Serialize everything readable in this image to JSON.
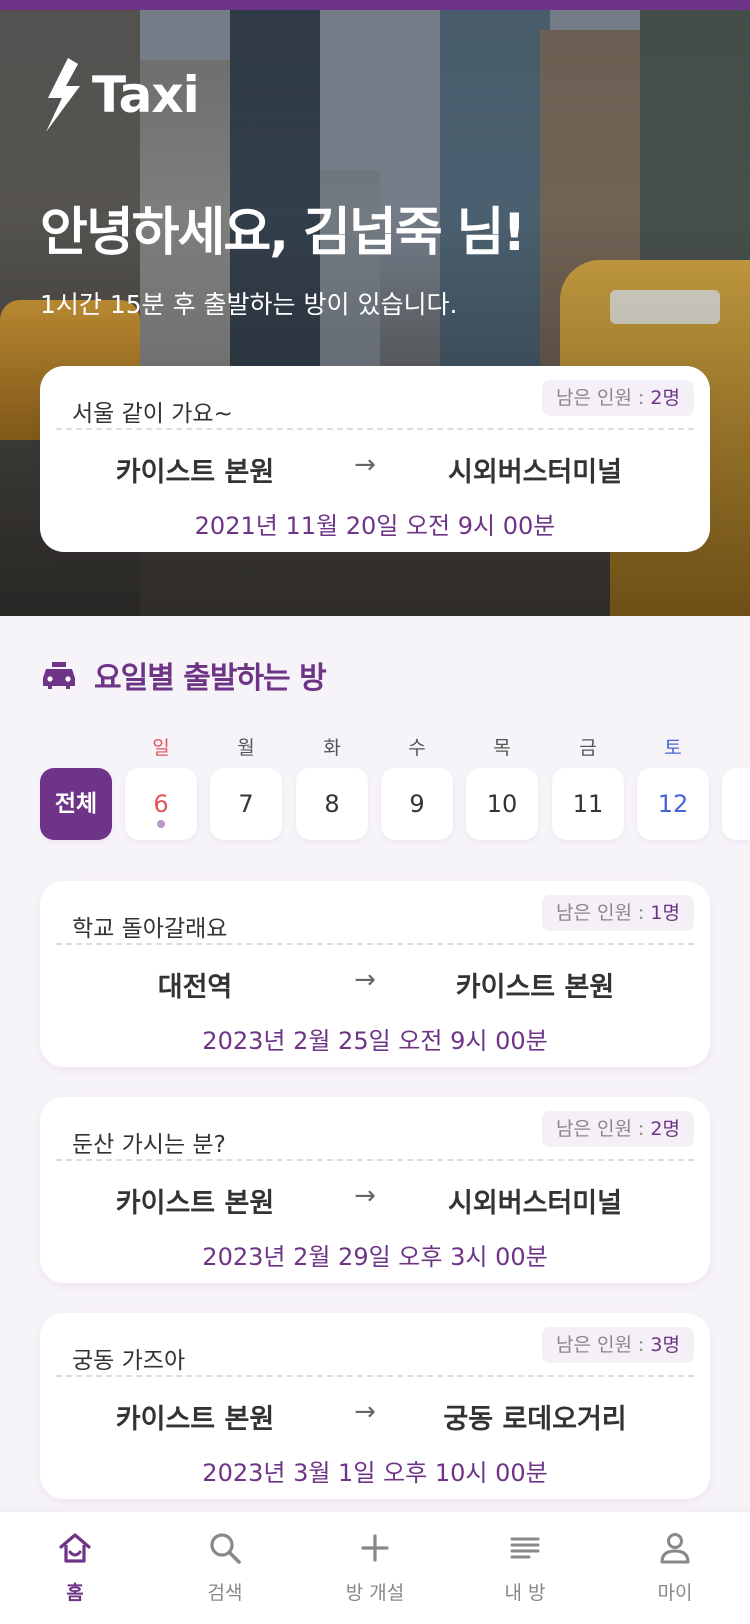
{
  "app": {
    "logo_text": "Taxi"
  },
  "hero": {
    "greeting": "안녕하세요, 김넙죽 님!",
    "subtitle": "1시간 15분 후 출발하는 방이 있습니다.",
    "card": {
      "title": "서울 같이 가요~",
      "remaining_label": "남은 인원 : ",
      "remaining_count": "2명",
      "from": "카이스트 본원",
      "arrow": "→",
      "to": "시외버스터미널",
      "datetime": "2021년 11월 20일 오전 9시 00분"
    }
  },
  "section": {
    "title": "요일별 출발하는 방",
    "icon": "taxi-icon"
  },
  "calendar": {
    "all_label": "전체",
    "days": [
      {
        "weekday": "일",
        "date": "6",
        "color": "#e0555e",
        "has_dot": true
      },
      {
        "weekday": "월",
        "date": "7",
        "color": "#333333"
      },
      {
        "weekday": "화",
        "date": "8",
        "color": "#333333"
      },
      {
        "weekday": "수",
        "date": "9",
        "color": "#333333"
      },
      {
        "weekday": "목",
        "date": "10",
        "color": "#333333"
      },
      {
        "weekday": "금",
        "date": "11",
        "color": "#333333"
      },
      {
        "weekday": "토",
        "date": "12",
        "color": "#4a63d8"
      }
    ]
  },
  "rooms": [
    {
      "title": "학교 돌아갈래요",
      "remaining_label": "남은 인원 : ",
      "remaining_count": "1명",
      "from": "대전역",
      "arrow": "→",
      "to": "카이스트 본원",
      "datetime": "2023년 2월 25일 오전 9시 00분"
    },
    {
      "title": "둔산 가시는 분?",
      "remaining_label": "남은 인원 : ",
      "remaining_count": "2명",
      "from": "카이스트 본원",
      "arrow": "→",
      "to": "시외버스터미널",
      "datetime": "2023년 2월 29일 오후 3시 00분"
    },
    {
      "title": "궁동 가즈아",
      "remaining_label": "남은 인원 : ",
      "remaining_count": "3명",
      "from": "카이스트 본원",
      "arrow": "→",
      "to": "궁동 로데오거리",
      "datetime": "2023년 3월 1일 오후 10시 00분"
    }
  ],
  "nav": [
    {
      "label": "홈",
      "icon": "home-icon",
      "active": true
    },
    {
      "label": "검색",
      "icon": "search-icon"
    },
    {
      "label": "방 개설",
      "icon": "plus-icon"
    },
    {
      "label": "내 방",
      "icon": "list-icon"
    },
    {
      "label": "마이",
      "icon": "person-icon"
    }
  ],
  "colors": {
    "accent": "#6e3487",
    "sunday": "#e0555e",
    "saturday": "#4a63d8"
  }
}
